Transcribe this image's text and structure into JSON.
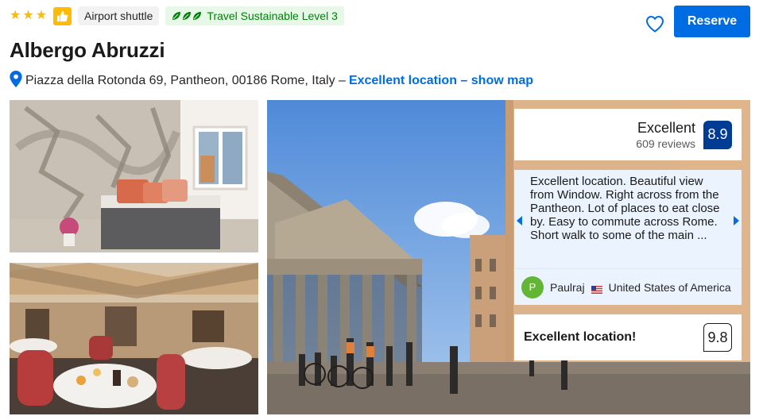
{
  "header": {
    "stars": 3,
    "amenity_badge": "Airport shuttle",
    "sustainability_badge": "Travel Sustainable Level 3",
    "reserve_label": "Reserve",
    "colors": {
      "accent": "#006ce4",
      "star": "#febb02",
      "sustain": "#008009",
      "score": "#003b95"
    }
  },
  "property": {
    "name": "Albergo Abruzzi",
    "address": "Piazza della Rotonda 69, Pantheon, 00186 Rome, Italy –",
    "location_link": "Excellent location – show map"
  },
  "gallery": {
    "photos": [
      "bedroom-photo",
      "restaurant-terrace-photo",
      "pantheon-photo"
    ]
  },
  "review_summary": {
    "rating_word": "Excellent",
    "review_count": "609 reviews",
    "score": "8.9"
  },
  "featured_review": {
    "text": "Excellent location. Beautiful view from Window. Right across from the Pantheon. Lot of places to eat close by. Easy to commute across Rome. Short walk to some of the main ...",
    "avatar_initial": "P",
    "reviewer_name": "Paulraj",
    "reviewer_country": "United States of America"
  },
  "location_score": {
    "label": "Excellent location!",
    "score": "9.8"
  }
}
